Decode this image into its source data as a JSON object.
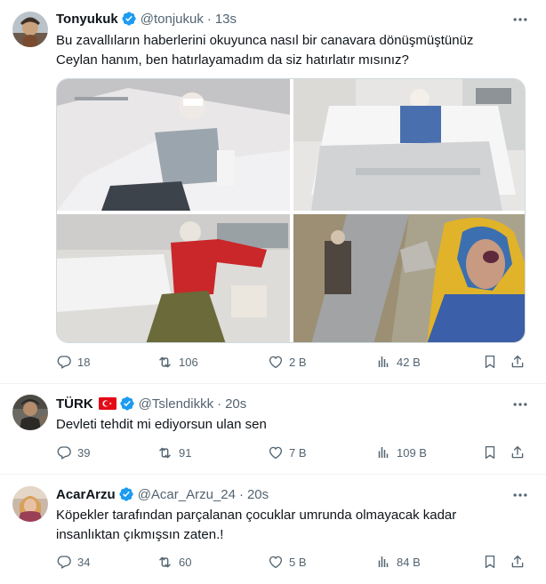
{
  "tweets": [
    {
      "name": "Tonyukuk",
      "handle": "@tonjukuk",
      "time": "13s",
      "text_lines": [
        "Bu zavallıların haberlerini okuyunca nasıl bir canavara dönüşmüştünüz",
        "Ceylan hanım, ben hatırlayamadım da siz hatırlatır mısınız?"
      ],
      "stats": {
        "replies": "18",
        "retweets": "106",
        "likes": "2 B",
        "views": "42 B"
      }
    },
    {
      "name": "TÜRK",
      "handle": "@Tslendikkk",
      "time": "20s",
      "text_lines": [
        "Devleti tehdit mi ediyorsun ulan sen"
      ],
      "stats": {
        "replies": "39",
        "retweets": "91",
        "likes": "7 B",
        "views": "109 B"
      }
    },
    {
      "name": "AcarArzu",
      "handle": "@Acar_Arzu_24",
      "time": "20s",
      "text_lines": [
        "Köpekler tarafından parçalanan çocuklar umrunda olmayacak kadar",
        "insanlıktan çıkmışsın zaten.!"
      ],
      "stats": {
        "replies": "34",
        "retweets": "60",
        "likes": "5 B",
        "views": "84 B"
      }
    }
  ],
  "separator": "·",
  "colors": {
    "verified": "#1d9bf0",
    "secondary": "#536471",
    "text": "#0f1419",
    "divider": "#eff3f4",
    "flag": "#e30a17"
  },
  "icons": [
    "verified-badge-icon",
    "more-icon",
    "reply-icon",
    "retweet-icon",
    "like-icon",
    "views-icon",
    "bookmark-icon",
    "share-icon",
    "turkish-flag-icon"
  ]
}
